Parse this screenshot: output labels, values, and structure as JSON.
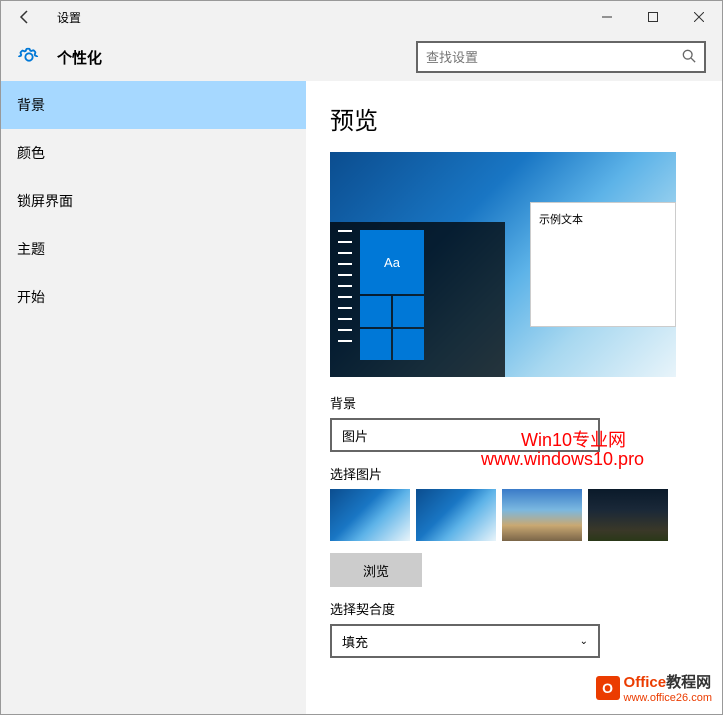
{
  "titlebar": {
    "title": "设置"
  },
  "header": {
    "title": "个性化",
    "search_placeholder": "查找设置"
  },
  "sidebar": {
    "items": [
      {
        "label": "背景",
        "active": true
      },
      {
        "label": "颜色"
      },
      {
        "label": "锁屏界面"
      },
      {
        "label": "主题"
      },
      {
        "label": "开始"
      }
    ]
  },
  "main": {
    "preview_title": "预览",
    "sample_text": "示例文本",
    "tile_text": "Aa",
    "background_label": "背景",
    "background_value": "图片",
    "choose_picture_label": "选择图片",
    "browse_label": "浏览",
    "fit_label": "选择契合度",
    "fit_value": "填充"
  },
  "watermarks": {
    "line1": "Win10专业网",
    "line2": "www.windows10.pro",
    "logo_brand": "Office",
    "logo_suffix": "教程网",
    "logo_url": "www.office26.com"
  }
}
